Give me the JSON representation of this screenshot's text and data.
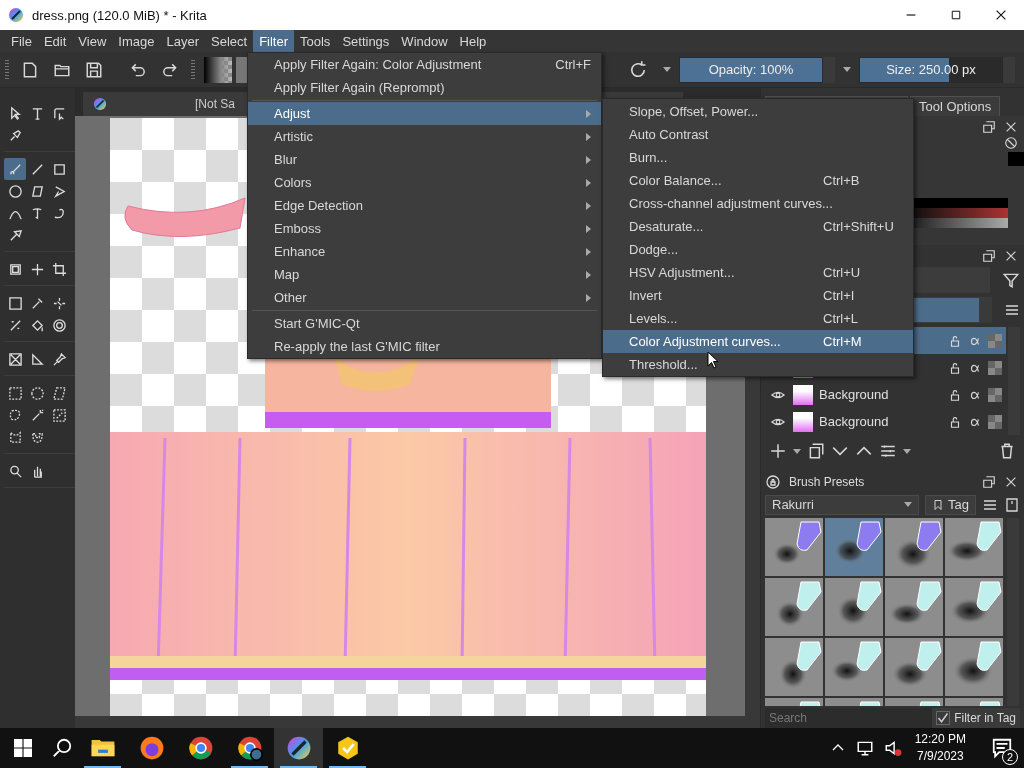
{
  "window": {
    "title": "dress.png (120.0 MiB)  * - Krita"
  },
  "menubar": [
    {
      "label": "File",
      "selected": false
    },
    {
      "label": "Edit",
      "selected": false
    },
    {
      "label": "View",
      "selected": false
    },
    {
      "label": "Image",
      "selected": false
    },
    {
      "label": "Layer",
      "selected": false
    },
    {
      "label": "Select",
      "selected": false
    },
    {
      "label": "Filter",
      "selected": true
    },
    {
      "label": "Tools",
      "selected": false
    },
    {
      "label": "Settings",
      "selected": false
    },
    {
      "label": "Window",
      "selected": false
    },
    {
      "label": "Help",
      "selected": false
    }
  ],
  "toolbar": {
    "opacity": {
      "label": "Opacity: 100%",
      "level": 1
    },
    "size": {
      "label": "Size: 250.00 px",
      "level": 0.62
    }
  },
  "toolbox": {
    "groups": [
      [
        {
          "selected": false
        },
        {
          "selected": false
        },
        {
          "selected": false
        },
        {
          "selected": false
        }
      ],
      [
        {
          "selected": true
        },
        {
          "selected": false
        },
        {
          "selected": false
        },
        {
          "selected": false
        },
        {
          "selected": false
        },
        {
          "selected": false
        },
        {
          "selected": false
        },
        {
          "selected": false
        },
        {
          "selected": false
        },
        {
          "selected": false
        }
      ],
      [
        {
          "selected": false
        },
        {
          "selected": false
        },
        {
          "selected": false
        }
      ],
      [
        {
          "selected": false
        },
        {
          "selected": false
        },
        {
          "selected": false
        },
        {
          "selected": false
        },
        {
          "selected": false
        },
        {
          "selected": false
        }
      ],
      [
        {
          "selected": false
        },
        {
          "selected": false
        },
        {
          "selected": false
        }
      ],
      [
        {
          "selected": false
        },
        {
          "selected": false
        },
        {
          "selected": false
        },
        {
          "selected": false
        },
        {
          "selected": false
        },
        {
          "selected": false
        },
        {
          "selected": false
        },
        {
          "selected": false
        }
      ],
      [
        {
          "selected": false
        },
        {
          "selected": false
        }
      ]
    ]
  },
  "document": {
    "tab": "[Not Sa"
  },
  "filter_menu": {
    "groups": [
      [
        {
          "label": "Apply Filter Again: Color Adjustment",
          "shortcut": "Ctrl+F",
          "submenu": false,
          "selected": false
        },
        {
          "label": "Apply Filter Again (Reprompt)",
          "submenu": false,
          "selected": false
        }
      ],
      [
        {
          "label": "Adjust",
          "submenu": true,
          "selected": true
        },
        {
          "label": "Artistic",
          "submenu": true,
          "selected": false
        },
        {
          "label": "Blur",
          "submenu": true,
          "selected": false
        },
        {
          "label": "Colors",
          "submenu": true,
          "selected": false
        },
        {
          "label": "Edge Detection",
          "submenu": true,
          "selected": false
        },
        {
          "label": "Emboss",
          "submenu": true,
          "selected": false
        },
        {
          "label": "Enhance",
          "submenu": true,
          "selected": false
        },
        {
          "label": "Map",
          "submenu": true,
          "selected": false
        },
        {
          "label": "Other",
          "submenu": true,
          "selected": false
        }
      ],
      [
        {
          "label": "Start G'MIC-Qt",
          "submenu": false,
          "selected": false
        },
        {
          "label": "Re-apply the last G'MIC filter",
          "submenu": false,
          "selected": false
        }
      ]
    ]
  },
  "adjust_submenu": {
    "items": [
      {
        "label": "Slope, Offset, Power...",
        "selected": false
      },
      {
        "label": "Auto Contrast",
        "selected": false
      },
      {
        "label": "Burn...",
        "selected": false
      },
      {
        "label": "Color Balance...",
        "shortcut": "Ctrl+B",
        "selected": false
      },
      {
        "label": "Cross-channel adjustment curves...",
        "selected": false
      },
      {
        "label": "Desaturate...",
        "shortcut": "Ctrl+Shift+U",
        "selected": false
      },
      {
        "label": "Dodge...",
        "selected": false
      },
      {
        "label": "HSV Adjustment...",
        "shortcut": "Ctrl+U",
        "selected": false
      },
      {
        "label": "Invert",
        "shortcut": "Ctrl+I",
        "selected": false
      },
      {
        "label": "Levels...",
        "shortcut": "Ctrl+L",
        "selected": false
      },
      {
        "label": "Color Adjustment curves...",
        "shortcut": "Ctrl+M",
        "selected": true
      },
      {
        "label": "Threshold...",
        "selected": false
      }
    ]
  },
  "dock": {
    "tabs": [
      {
        "label": "Tool Options",
        "selected": false
      }
    ]
  },
  "layers": {
    "rows": [
      {
        "selected": true
      },
      {
        "selected": false
      },
      {
        "name": "Background",
        "selected": false
      },
      {
        "name": "Background",
        "selected": false
      }
    ],
    "opacity": {
      "level": 1
    }
  },
  "brush_presets": {
    "title": "Brush Presets",
    "resource": "Rakurri",
    "tag_button": "Tag",
    "search": {
      "placeholder": "Search"
    },
    "filter_in_tag": {
      "label": "Filter in Tag",
      "checked": true
    },
    "presets": [
      {
        "selected": false
      },
      {
        "selected": true
      },
      {
        "selected": false
      },
      {
        "selected": false
      },
      {
        "selected": false
      },
      {
        "selected": false
      },
      {
        "selected": false
      },
      {
        "selected": false
      },
      {
        "selected": false
      },
      {
        "selected": false
      },
      {
        "selected": false
      },
      {
        "selected": false
      },
      {
        "selected": false
      },
      {
        "selected": false
      },
      {
        "selected": false
      },
      {
        "selected": false
      }
    ]
  },
  "taskbar": {
    "apps": [
      {
        "running": true,
        "active": false
      },
      {
        "running": false,
        "active": false
      },
      {
        "running": false,
        "active": false
      },
      {
        "running": true,
        "active": false
      },
      {
        "running": true,
        "active": true
      },
      {
        "running": true,
        "active": false
      }
    ],
    "time": "12:20 PM",
    "date": "7/9/2023",
    "notifications": "2"
  }
}
